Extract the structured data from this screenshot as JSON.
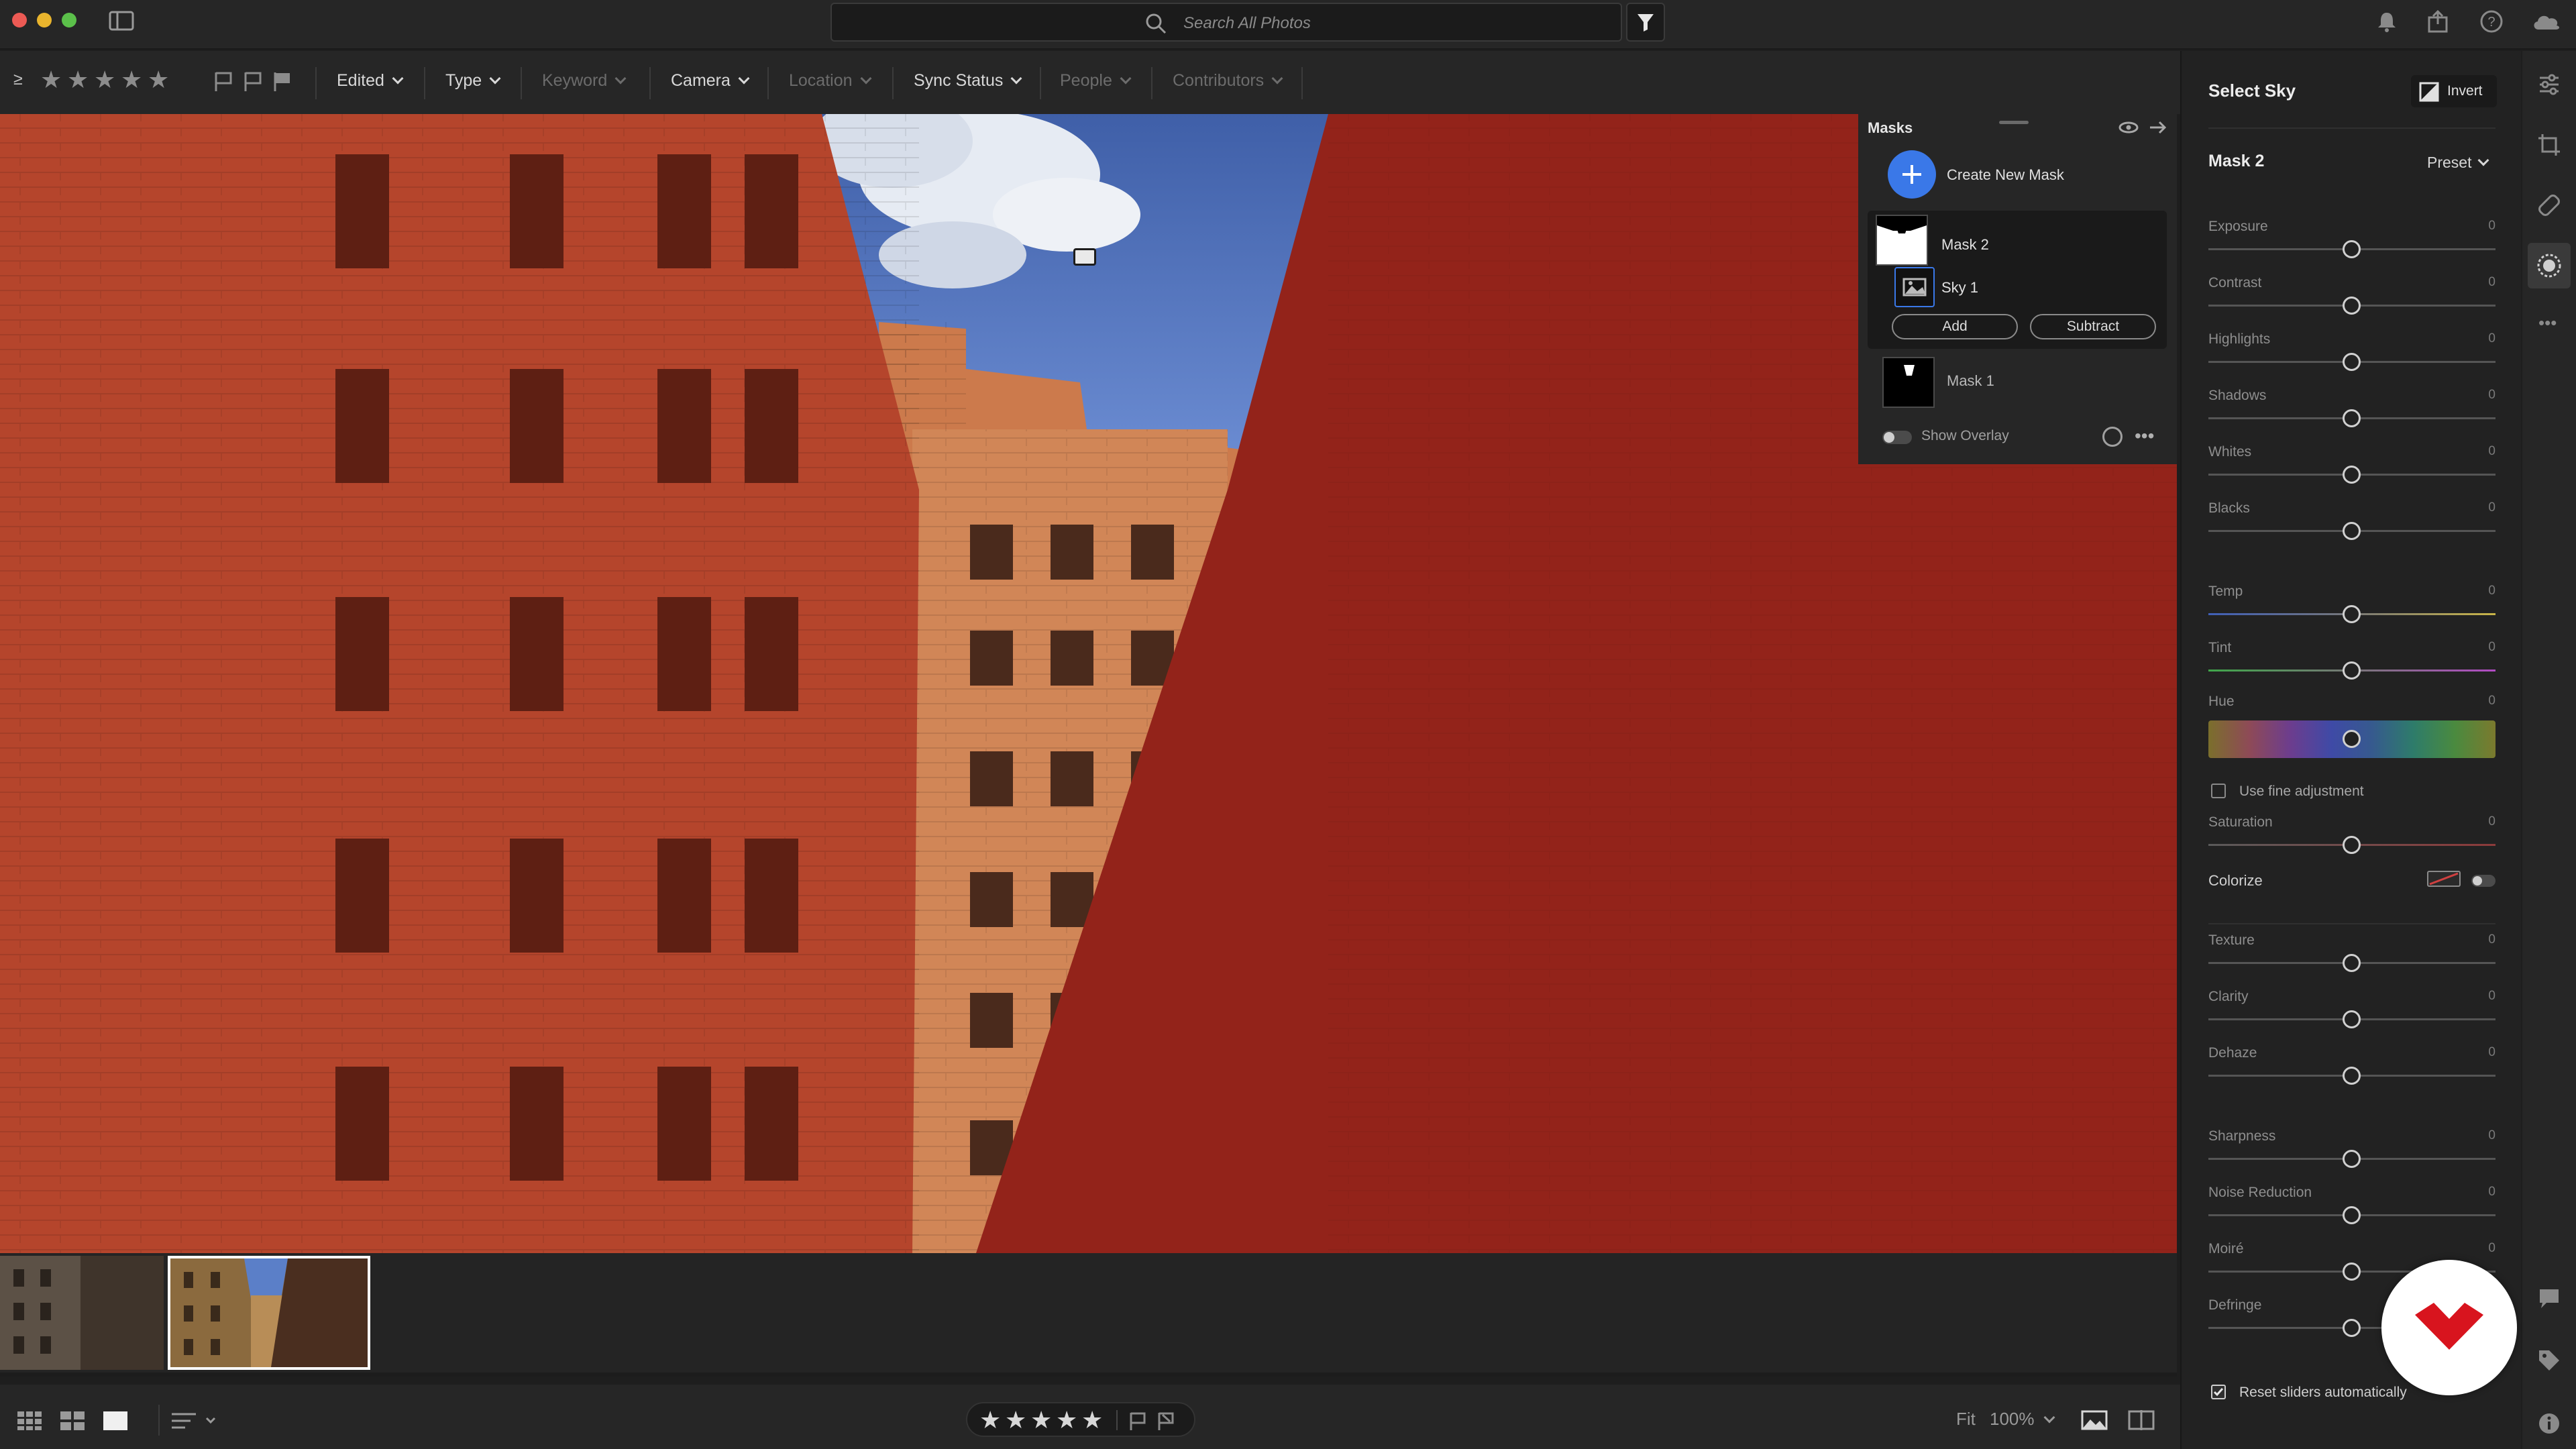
{
  "topbar": {
    "search_placeholder": "Search All Photos"
  },
  "filterbar": {
    "items": [
      {
        "label": "Edited",
        "enabled": true
      },
      {
        "label": "Type",
        "enabled": true
      },
      {
        "label": "Keyword",
        "enabled": false
      },
      {
        "label": "Camera",
        "enabled": true
      },
      {
        "label": "Location",
        "enabled": false
      },
      {
        "label": "Sync Status",
        "enabled": true
      },
      {
        "label": "People",
        "enabled": false
      },
      {
        "label": "Contributors",
        "enabled": false
      }
    ],
    "toggle_glyph": "≥"
  },
  "masks_panel": {
    "title": "Masks",
    "create_label": "Create New Mask",
    "mask2_label": "Mask 2",
    "sky1_label": "Sky 1",
    "add_label": "Add",
    "subtract_label": "Subtract",
    "mask1_label": "Mask 1",
    "overlay_label": "Show Overlay"
  },
  "right_panel": {
    "title": "Select Sky",
    "invert_label": "Invert",
    "mask_name": "Mask 2",
    "preset_label": "Preset",
    "sliders_light": [
      {
        "label": "Exposure",
        "value": "0"
      },
      {
        "label": "Contrast",
        "value": "0"
      },
      {
        "label": "Highlights",
        "value": "0"
      },
      {
        "label": "Shadows",
        "value": "0"
      },
      {
        "label": "Whites",
        "value": "0"
      },
      {
        "label": "Blacks",
        "value": "0"
      }
    ],
    "sliders_color": [
      {
        "label": "Temp",
        "value": "0"
      },
      {
        "label": "Tint",
        "value": "0"
      }
    ],
    "hue": {
      "label": "Hue",
      "value": "0"
    },
    "fine_adjust_label": "Use fine adjustment",
    "saturation": {
      "label": "Saturation",
      "value": "0"
    },
    "colorize_label": "Colorize",
    "sliders_effects": [
      {
        "label": "Texture",
        "value": "0"
      },
      {
        "label": "Clarity",
        "value": "0"
      },
      {
        "label": "Dehaze",
        "value": "0"
      }
    ],
    "sliders_detail": [
      {
        "label": "Sharpness",
        "value": "0"
      },
      {
        "label": "Noise Reduction",
        "value": "0"
      },
      {
        "label": "Moiré",
        "value": "0"
      },
      {
        "label": "Defringe",
        "value": "0"
      }
    ],
    "reset_label": "Reset sliders automatically"
  },
  "bottombar": {
    "fit_label": "Fit",
    "zoom_label": "100%"
  },
  "colors": {
    "accent_blue": "#3a78e8",
    "overlay_red": "#9b2417"
  }
}
